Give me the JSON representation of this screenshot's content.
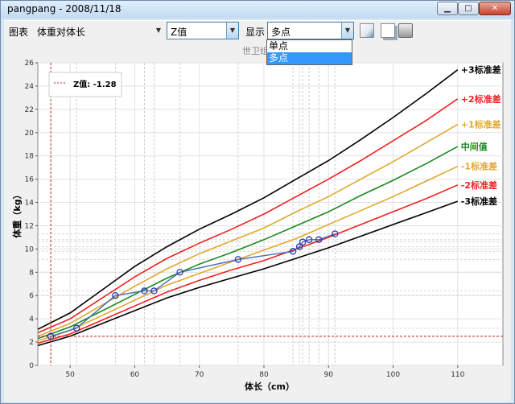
{
  "window": {
    "title": "pangpang - 2008/11/18"
  },
  "toolbar": {
    "chart_label": "图表",
    "chart_value": "体重对体长",
    "metric_value": "Z值",
    "display_label": "显示",
    "display_value": "多点"
  },
  "dropdown": {
    "options": [
      "单点",
      "多点"
    ],
    "selected": "多点"
  },
  "chart_header_partial": "世卫组",
  "legend_box": {
    "text": "Z值: -1.28"
  },
  "chart_data": {
    "type": "line",
    "xlabel": "体长（cm）",
    "ylabel": "体重（kg）",
    "xlim": [
      45,
      117
    ],
    "ylim": [
      0,
      26
    ],
    "x_ticks": [
      50,
      60,
      70,
      80,
      90,
      100,
      110
    ],
    "y_ticks": [
      0,
      2,
      4,
      6,
      8,
      10,
      12,
      14,
      16,
      18,
      20,
      22,
      24,
      26
    ],
    "grid": true,
    "curve_x": [
      45,
      50,
      55,
      60,
      65,
      70,
      75,
      80,
      85,
      90,
      95,
      100,
      105,
      110
    ],
    "series": [
      {
        "name": "+3标准差",
        "color": "#000000",
        "values": [
          3.1,
          4.5,
          6.5,
          8.5,
          10.2,
          11.7,
          13.0,
          14.4,
          16.0,
          17.6,
          19.4,
          21.3,
          23.3,
          25.4
        ]
      },
      {
        "name": "+2标准差",
        "color": "#ee2222",
        "values": [
          2.8,
          4.0,
          5.8,
          7.6,
          9.2,
          10.5,
          11.7,
          13.0,
          14.5,
          16.0,
          17.6,
          19.3,
          21.0,
          22.9
        ]
      },
      {
        "name": "+1标准差",
        "color": "#e0a830",
        "values": [
          2.5,
          3.6,
          5.2,
          6.8,
          8.3,
          9.6,
          10.7,
          11.8,
          13.2,
          14.5,
          16.0,
          17.5,
          19.1,
          20.7
        ]
      },
      {
        "name": "中间值",
        "color": "#1a8a1a",
        "values": [
          2.3,
          3.3,
          4.7,
          6.1,
          7.5,
          8.7,
          9.7,
          10.8,
          12.0,
          13.2,
          14.6,
          15.9,
          17.3,
          18.8
        ]
      },
      {
        "name": "-1标准差",
        "color": "#e0a830",
        "values": [
          2.1,
          3.0,
          4.3,
          5.6,
          6.9,
          7.9,
          8.9,
          9.9,
          10.9,
          12.1,
          13.3,
          14.5,
          15.8,
          17.1
        ]
      },
      {
        "name": "-2标准差",
        "color": "#ee2222",
        "values": [
          1.9,
          2.7,
          3.9,
          5.1,
          6.3,
          7.3,
          8.2,
          9.0,
          10.0,
          11.0,
          12.1,
          13.2,
          14.3,
          15.5
        ]
      },
      {
        "name": "-3标准差",
        "color": "#000000",
        "values": [
          1.7,
          2.5,
          3.6,
          4.7,
          5.8,
          6.7,
          7.5,
          8.3,
          9.2,
          10.1,
          11.1,
          12.1,
          13.1,
          14.1
        ]
      }
    ],
    "measurements": {
      "x": [
        47,
        51,
        57,
        61.5,
        63,
        67,
        76,
        84.5,
        85.5,
        86,
        87,
        88.5,
        91
      ],
      "y": [
        2.5,
        3.2,
        6.0,
        6.4,
        6.4,
        8.0,
        9.1,
        9.8,
        10.2,
        10.6,
        10.8,
        10.8,
        11.3
      ]
    },
    "reference_line": {
      "x": 47,
      "y": 2.5
    }
  }
}
